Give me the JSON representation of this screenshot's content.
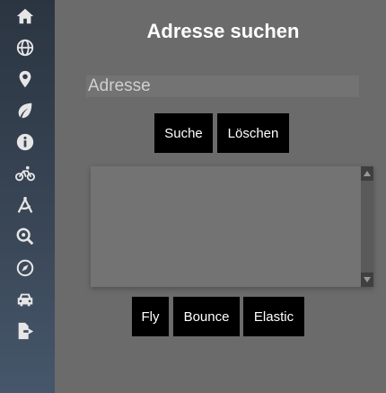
{
  "sidebar": {
    "items": [
      {
        "icon": "home-icon"
      },
      {
        "icon": "globe-icon"
      },
      {
        "icon": "map-marker-icon"
      },
      {
        "icon": "leaf-icon"
      },
      {
        "icon": "info-icon"
      },
      {
        "icon": "bicycle-icon"
      },
      {
        "icon": "compass-drafting-icon"
      },
      {
        "icon": "search-location-icon"
      },
      {
        "icon": "compass-icon"
      },
      {
        "icon": "car-icon"
      },
      {
        "icon": "file-export-icon"
      }
    ]
  },
  "header": {
    "title": "Adresse suchen"
  },
  "search": {
    "placeholder": "Adresse",
    "value": ""
  },
  "buttons": {
    "search": "Suche",
    "clear": "Löschen"
  },
  "animation_buttons": {
    "fly": "Fly",
    "bounce": "Bounce",
    "elastic": "Elastic"
  },
  "colors": {
    "sidebar_top": "#2b3542",
    "background": "#6b6b6b",
    "button": "#000000"
  }
}
